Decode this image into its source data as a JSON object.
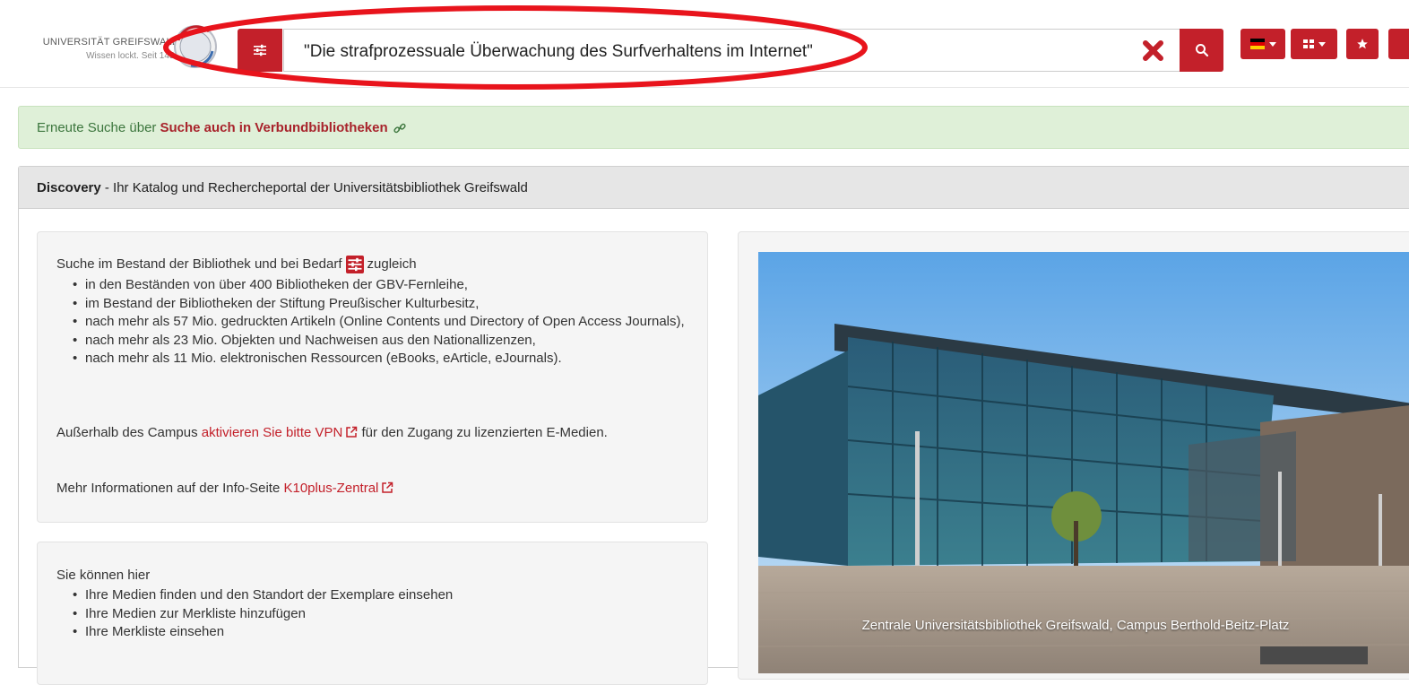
{
  "header": {
    "logo_name": "UNIVERSITÄT GREIFSWALD",
    "logo_tagline": "Wissen lockt. Seit 1456",
    "search_query": "\"Die strafprozessuale Überwachung des Surfverhaltens im Internet\""
  },
  "alert": {
    "prefix": "Erneute Suche über",
    "link": "Suche auch in Verbundbibliotheken"
  },
  "discovery": {
    "title_bold": "Discovery",
    "title_rest": " - Ihr Katalog und Rechercheportal der Universitätsbibliothek Greifswald",
    "intro_before": "Suche im Bestand der Bibliothek und bei Bedarf",
    "intro_after": "zugleich",
    "bullets": [
      "in den Beständen von über 400 Bibliotheken der GBV-Fernleihe,",
      "im Bestand der Bibliotheken der Stiftung Preußischer Kulturbesitz,",
      "nach mehr als 57 Mio. gedruckten Artikeln (Online Contents und Directory of Open Access Journals),",
      "nach mehr als 23 Mio. Objekten und Nachweisen aus den Nationallizenzen,",
      "nach mehr als 11 Mio. elektronischen Ressourcen (eBooks, eArticle, eJournals)."
    ],
    "vpn_before": "Außerhalb des Campus",
    "vpn_link": "aktivieren Sie bitte VPN",
    "vpn_after": "für den Zugang zu lizenzierten E-Medien.",
    "more_before": "Mehr Informationen auf der Info-Seite",
    "more_link": "K10plus-Zentral",
    "can_intro": "Sie können hier",
    "can_bullets": [
      "Ihre Medien finden und den Standort der Exemplare einsehen",
      "Ihre Medien zur Merkliste hinzufügen",
      "Ihre Merkliste einsehen"
    ],
    "photo_caption": "Zentrale Universitätsbibliothek Greifswald, Campus Berthold-Beitz-Platz"
  },
  "colors": {
    "brand_red": "#c3202a",
    "alert_bg": "#dff0d8",
    "alert_text": "#3c763d",
    "highlight": "#e8141c"
  }
}
